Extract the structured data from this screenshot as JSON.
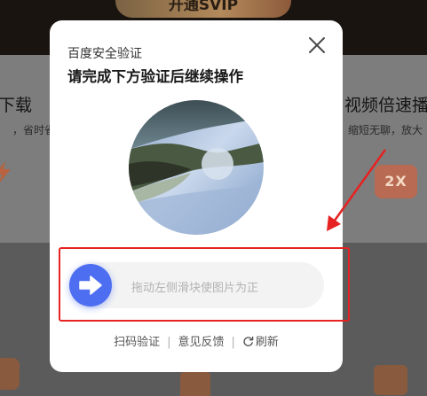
{
  "background": {
    "vip_button_label": "开通SVIP",
    "left_feature": {
      "title": "下载",
      "subtitle": "，省时省"
    },
    "right_feature": {
      "title": "视频倍速播",
      "subtitle": "缩短无聊，放大"
    },
    "speed_badge": "2X"
  },
  "dialog": {
    "small_title": "百度安全验证",
    "title": "请完成下方验证后继续操作",
    "close_icon": "close-icon",
    "slider_hint": "拖动左侧滑块使图片为正",
    "slider_icon": "arrow-right-icon",
    "footer": {
      "scan_label": "扫码验证",
      "feedback_label": "意见反馈",
      "refresh_label": "刷新"
    }
  },
  "colors": {
    "accent": "#4e6ef2",
    "annotation_red": "#e62222",
    "dialog_bg": "#ffffff"
  }
}
